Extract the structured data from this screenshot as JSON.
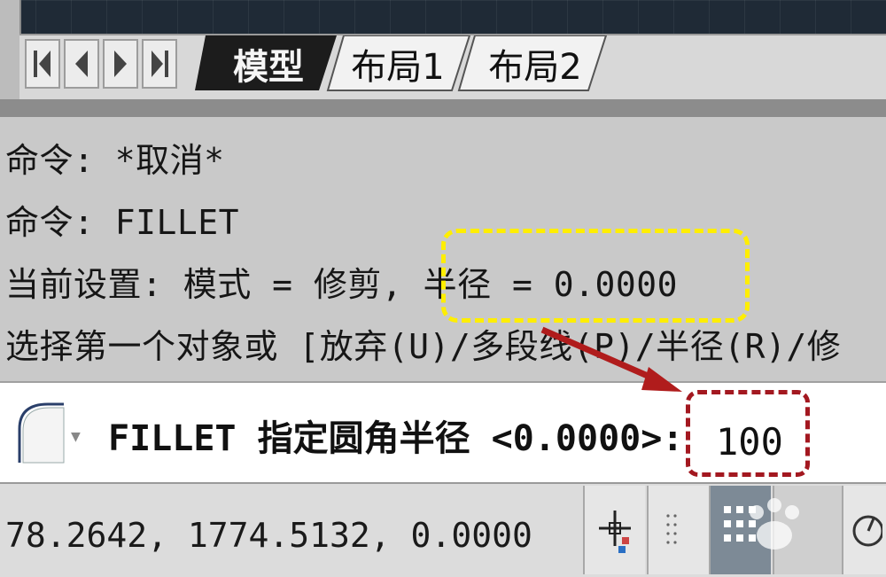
{
  "tabs": {
    "nav_buttons": [
      "first-tab-button",
      "prev-tab-button",
      "next-tab-button",
      "last-tab-button"
    ],
    "items": [
      {
        "label": "模型",
        "active": true
      },
      {
        "label": "布局1",
        "active": false
      },
      {
        "label": "布局2",
        "active": false
      }
    ]
  },
  "history": {
    "lines": [
      "命令: *取消*",
      "命令: FILLET",
      "当前设置: 模式 = 修剪, 半径 = 0.0000",
      "选择第一个对象或 [放弃(U)/多段线(P)/半径(R)/修"
    ]
  },
  "command_line": {
    "icon": "fillet-icon",
    "prompt": "FILLET 指定圆角半径 <0.0000>:",
    "value": "100"
  },
  "status": {
    "coordinates": "78.2642, 1774.5132, 0.0000"
  },
  "colors": {
    "highlight_yellow": "#ffee00",
    "highlight_red": "#a31820",
    "arrow": "#b01c1c"
  }
}
